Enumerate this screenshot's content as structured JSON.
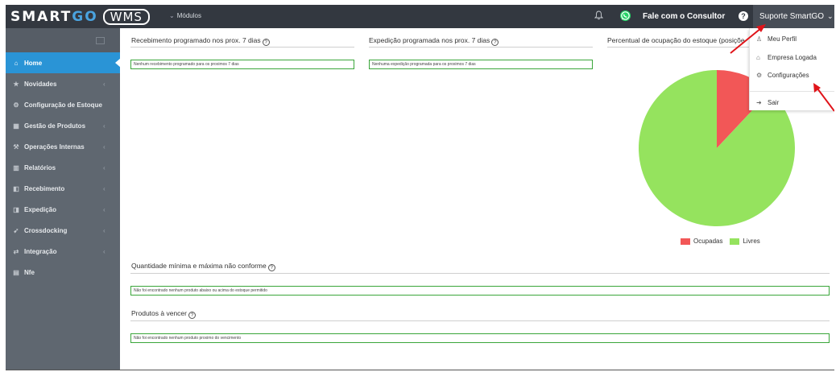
{
  "topbar": {
    "logo_smart": "SMART",
    "logo_go": "GO",
    "logo_wms": "WMS",
    "modules_label": "Módulos",
    "consult_label": "Fale com o Consultor",
    "user_label": "Suporte SmartGO",
    "help_icon": "?"
  },
  "sidebar": {
    "items": [
      {
        "label": "Home",
        "icon": "house-icon",
        "glyph": "⌂"
      },
      {
        "label": "Novidades",
        "icon": "star-icon",
        "glyph": "★"
      },
      {
        "label": "Configuração de Estoque",
        "icon": "cogs-icon",
        "glyph": "⚙"
      },
      {
        "label": "Gestão de Produtos",
        "icon": "barcode-icon",
        "glyph": "▦"
      },
      {
        "label": "Operações Internas",
        "icon": "tools-icon",
        "glyph": "⚒"
      },
      {
        "label": "Relatórios",
        "icon": "chart-icon",
        "glyph": "▥"
      },
      {
        "label": "Recebimento",
        "icon": "inbox-truck-icon",
        "glyph": "◧"
      },
      {
        "label": "Expedição",
        "icon": "truck-icon",
        "glyph": "◨"
      },
      {
        "label": "Crossdocking",
        "icon": "send-icon",
        "glyph": "➹"
      },
      {
        "label": "Integração",
        "icon": "exchange-icon",
        "glyph": "⇄"
      },
      {
        "label": "Nfe",
        "icon": "document-icon",
        "glyph": "▤"
      }
    ]
  },
  "panels": {
    "receiving": {
      "title": "Recebimento programado nos prox. 7 dias",
      "message": "Nenhum recebimento programado para os proximos 7 dias"
    },
    "shipping": {
      "title": "Expedição programada nos prox. 7 dias",
      "message": "Nenhuma expedição programada para os proximos 7 dias"
    },
    "occupancy": {
      "title": "Percentual de ocupação do estoque (posiçõe"
    },
    "minmax": {
      "title": "Quantidade mínima e máxima não conforme",
      "message": "Não foi encontrado nenhum produto abaixo ou acima do estoque permitido"
    },
    "expiring": {
      "title": "Produtos à vencer",
      "message": "Não foi encontrado nenhum produto proximo do vencimento"
    }
  },
  "chart_data": {
    "type": "pie",
    "categories": [
      "Ocupadas",
      "Livres"
    ],
    "values": [
      12,
      88
    ],
    "colors": [
      "#f25757",
      "#95e35e"
    ],
    "legend": "bottom"
  },
  "dropdown": {
    "items": [
      {
        "label": "Meu Perfil",
        "icon": "user-icon",
        "glyph": "♙"
      },
      {
        "label": "Empresa Logada",
        "icon": "home-outline-icon",
        "glyph": "⌂"
      },
      {
        "label": "Configurações",
        "icon": "settings-icon",
        "glyph": "⚙"
      },
      {
        "label": "Sair",
        "icon": "logout-icon",
        "glyph": "➜"
      }
    ]
  },
  "colors": {
    "topbar": "#333840",
    "sidebar": "#5f6770",
    "active": "#2a94d6",
    "panel_border": "#3aa63a",
    "annotation": "#e0141a"
  }
}
